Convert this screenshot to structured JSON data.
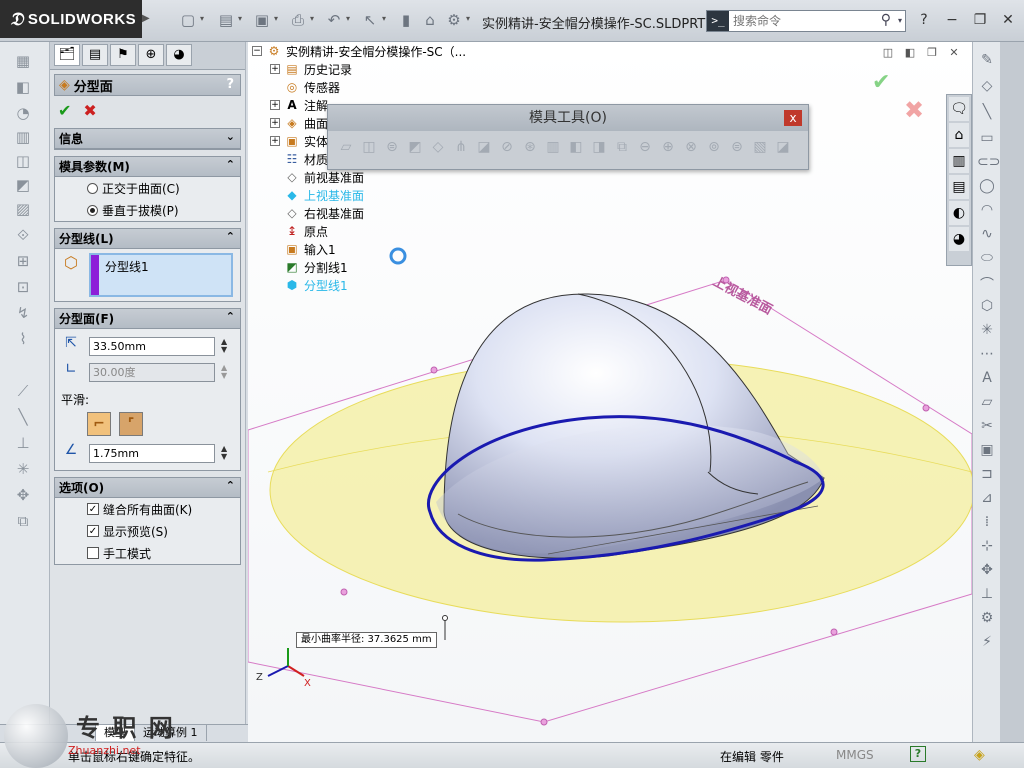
{
  "app": {
    "logo_text": "SOLIDWORKS",
    "document_title": "实例精讲-安全帽分模操作-SC.SLDPRT *",
    "search_placeholder": "搜索命令"
  },
  "property_manager": {
    "title": "分型面",
    "help_label": "?",
    "info_label": "信息",
    "mold_params": {
      "title": "模具参数(M)",
      "options": [
        "正交于曲面(C)",
        "垂直于拔模(P)"
      ],
      "selected": "垂直于拔模(P)"
    },
    "parting_line": {
      "title": "分型线(L)",
      "items": [
        "分型线1"
      ]
    },
    "parting_surface": {
      "title": "分型面(F)",
      "distance": "33.50mm",
      "angle": "30.00度",
      "smooth_label": "平滑:",
      "smooth_distance": "1.75mm"
    },
    "options": {
      "title": "选项(O)",
      "items": [
        {
          "label": "缝合所有曲面(K)",
          "checked": true
        },
        {
          "label": "显示预览(S)",
          "checked": true
        },
        {
          "label": "手工模式",
          "checked": false
        }
      ]
    }
  },
  "feature_tree": {
    "root": "实例精讲-安全帽分模操作-SC（...",
    "items": [
      {
        "label": "历史记录",
        "icon": "history-icon",
        "expandable": true
      },
      {
        "label": "传感器",
        "icon": "sensor-icon",
        "expandable": false
      },
      {
        "label": "注解",
        "icon": "annotation-icon",
        "expandable": true
      },
      {
        "label": "曲面",
        "icon": "surface-body-icon",
        "expandable": true
      },
      {
        "label": "实体",
        "icon": "solid-body-icon",
        "expandable": true
      },
      {
        "label": "材质",
        "icon": "material-icon",
        "expandable": false
      },
      {
        "label": "前视基准面",
        "icon": "plane-icon",
        "expandable": false
      },
      {
        "label": "上视基准面",
        "icon": "plane-icon",
        "expandable": false,
        "highlight": true
      },
      {
        "label": "右视基准面",
        "icon": "plane-icon",
        "expandable": false
      },
      {
        "label": "原点",
        "icon": "origin-icon",
        "expandable": false
      },
      {
        "label": "输入1",
        "icon": "import-icon",
        "expandable": false
      },
      {
        "label": "分割线1",
        "icon": "split-line-icon",
        "expandable": false
      },
      {
        "label": "分型线1",
        "icon": "parting-line-icon",
        "expandable": false,
        "highlight": true
      }
    ]
  },
  "mold_tools": {
    "title": "模具工具(O)",
    "close_label": "x"
  },
  "viewport": {
    "plane_label": "上视基准面",
    "tooltip": "最小曲率半径: 37.3625 mm",
    "axis_labels": [
      "Z",
      "X"
    ]
  },
  "bottom_tabs": [
    "模型",
    "运动算例 1"
  ],
  "status": {
    "message": "单击鼠标右键确定特征。",
    "edit_state": "在编辑 零件",
    "units": "MMGS",
    "help_label": "?"
  },
  "watermark": {
    "text": "专 职 网",
    "subtext": "Zhuanzhi.net"
  },
  "colors": {
    "parting_line": "#1a1ab0",
    "surface_preview": "#f5f0a8",
    "plane": "#d67ac6",
    "accent_purple": "#8d1fd8",
    "tree_highlight": "#29b8e8"
  }
}
